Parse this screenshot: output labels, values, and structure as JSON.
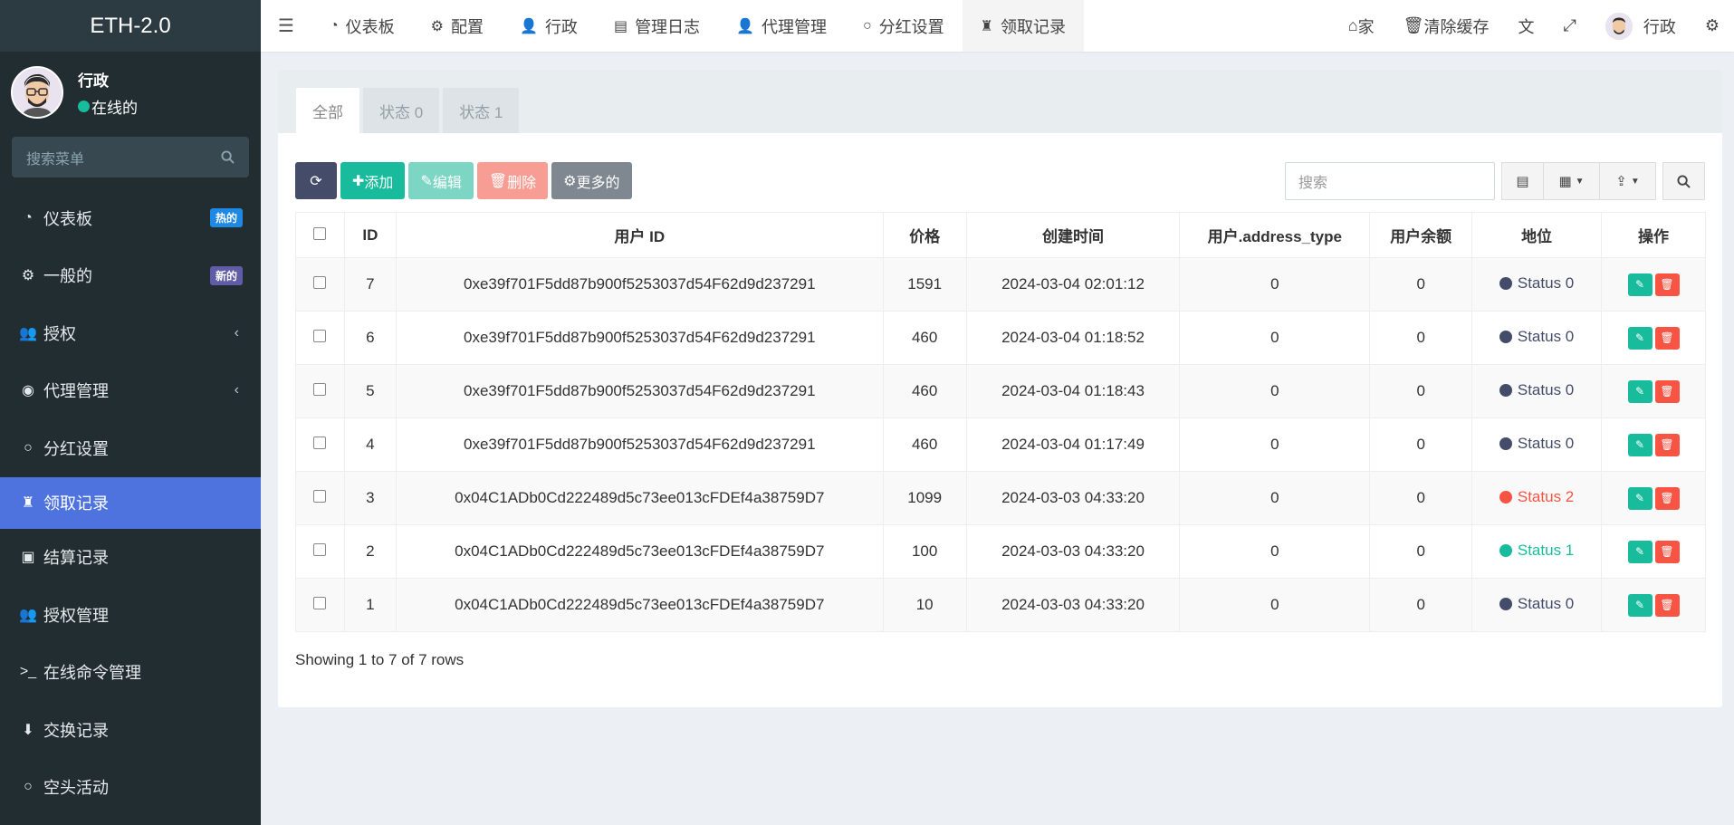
{
  "brand": "ETH-2.0",
  "user": {
    "name": "行政",
    "status": "在线的"
  },
  "sidebar_search_placeholder": "搜索菜单",
  "sidebar": {
    "items": [
      {
        "label": "仪表板",
        "icon": "dashboard-icon",
        "badge": "热的"
      },
      {
        "label": "一般的",
        "icon": "cogs-icon",
        "badge": "新的"
      },
      {
        "label": "授权",
        "icon": "users-icon",
        "chevron": "‹"
      },
      {
        "label": "代理管理",
        "icon": "user-circle-icon",
        "chevron": "‹"
      },
      {
        "label": "分红设置",
        "icon": "circle-icon"
      },
      {
        "label": "领取记录",
        "icon": "fort-icon"
      },
      {
        "label": "结算记录",
        "icon": "cc-icon"
      },
      {
        "label": "授权管理",
        "icon": "users-icon"
      },
      {
        "label": "在线命令管理",
        "icon": "terminal-icon"
      },
      {
        "label": "交换记录",
        "icon": "arrow-down-icon"
      },
      {
        "label": "空头活动",
        "icon": "circle-icon"
      }
    ]
  },
  "navbar": {
    "tabs": [
      {
        "label": "仪表板",
        "icon": "dashboard-icon"
      },
      {
        "label": "配置",
        "icon": "gear-icon"
      },
      {
        "label": "行政",
        "icon": "user-icon"
      },
      {
        "label": "管理日志",
        "icon": "list-icon"
      },
      {
        "label": "代理管理",
        "icon": "user-icon"
      },
      {
        "label": "分红设置",
        "icon": "circle-icon"
      },
      {
        "label": "领取记录",
        "icon": "fort-icon"
      }
    ],
    "home": "家",
    "clear_cache": "清除缓存",
    "user": "行政"
  },
  "panel": {
    "tabs": [
      "全部",
      "状态 0",
      "状态 1"
    ],
    "buttons": {
      "add": "添加",
      "edit": "编辑",
      "delete": "删除",
      "more": "更多的"
    },
    "search_placeholder": "搜索"
  },
  "table": {
    "columns": [
      "ID",
      "用户 ID",
      "价格",
      "创建时间",
      "用户.address_type",
      "用户余额",
      "地位",
      "操作"
    ],
    "rows": [
      {
        "id": "7",
        "user_id": "0xe39f701F5dd87b900f5253037d54F62d9d237291",
        "price": "1591",
        "created": "2024-03-04 02:01:12",
        "address_type": "0",
        "balance": "0",
        "status": "Status 0",
        "status_color": "#444c69",
        "status_text_color": "#444c69"
      },
      {
        "id": "6",
        "user_id": "0xe39f701F5dd87b900f5253037d54F62d9d237291",
        "price": "460",
        "created": "2024-03-04 01:18:52",
        "address_type": "0",
        "balance": "0",
        "status": "Status 0",
        "status_color": "#444c69",
        "status_text_color": "#444c69"
      },
      {
        "id": "5",
        "user_id": "0xe39f701F5dd87b900f5253037d54F62d9d237291",
        "price": "460",
        "created": "2024-03-04 01:18:43",
        "address_type": "0",
        "balance": "0",
        "status": "Status 0",
        "status_color": "#444c69",
        "status_text_color": "#444c69"
      },
      {
        "id": "4",
        "user_id": "0xe39f701F5dd87b900f5253037d54F62d9d237291",
        "price": "460",
        "created": "2024-03-04 01:17:49",
        "address_type": "0",
        "balance": "0",
        "status": "Status 0",
        "status_color": "#444c69",
        "status_text_color": "#444c69"
      },
      {
        "id": "3",
        "user_id": "0x04C1ADb0Cd222489d5c73ee013cFDEf4a38759D7",
        "price": "1099",
        "created": "2024-03-03 04:33:20",
        "address_type": "0",
        "balance": "0",
        "status": "Status 2",
        "status_color": "#f75444",
        "status_text_color": "#f75444"
      },
      {
        "id": "2",
        "user_id": "0x04C1ADb0Cd222489d5c73ee013cFDEf4a38759D7",
        "price": "100",
        "created": "2024-03-03 04:33:20",
        "address_type": "0",
        "balance": "0",
        "status": "Status 1",
        "status_color": "#18bc9c",
        "status_text_color": "#18bc9c"
      },
      {
        "id": "1",
        "user_id": "0x04C1ADb0Cd222489d5c73ee013cFDEf4a38759D7",
        "price": "10",
        "created": "2024-03-03 04:33:20",
        "address_type": "0",
        "balance": "0",
        "status": "Status 0",
        "status_color": "#444c69",
        "status_text_color": "#444c69"
      }
    ],
    "footer": "Showing 1 to 7 of 7 rows"
  },
  "colors": {
    "sidebar_bg": "#222d32",
    "active": "#4e73df",
    "success": "#18bc9c",
    "danger": "#f75444"
  }
}
